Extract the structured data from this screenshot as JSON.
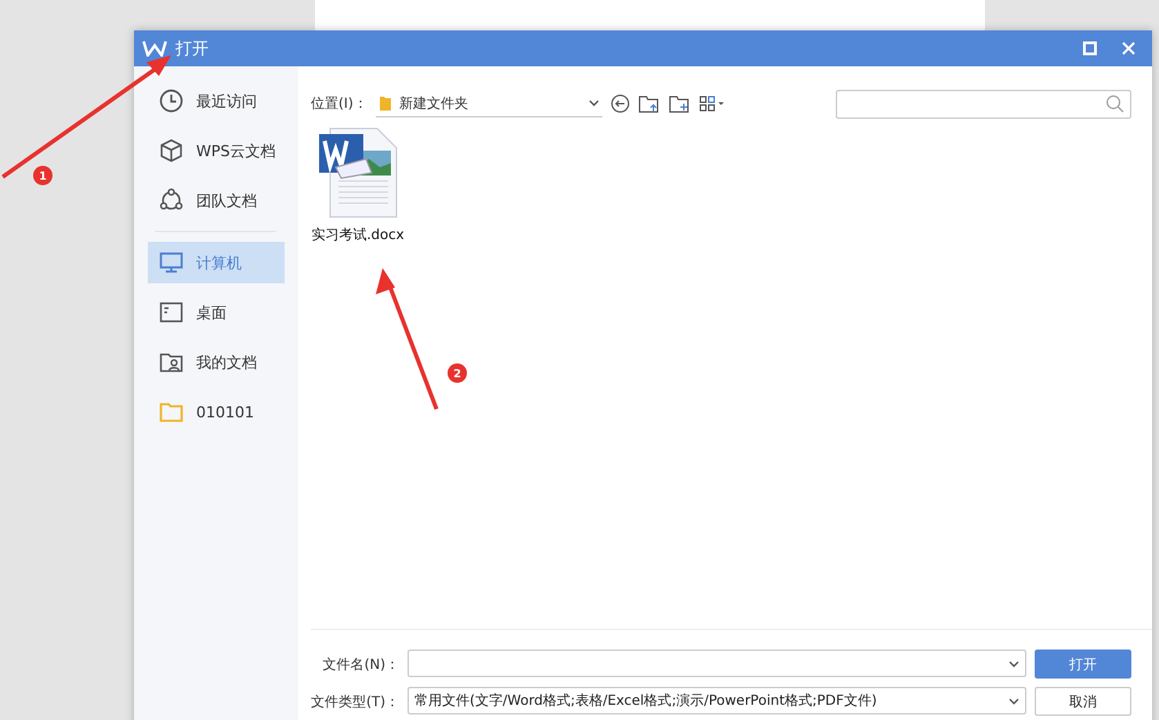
{
  "window": {
    "title": "打开"
  },
  "sidebar": {
    "items": [
      {
        "label": "最近访问",
        "selected": false
      },
      {
        "label": "WPS云文档",
        "selected": false
      },
      {
        "label": "团队文档",
        "selected": false
      },
      {
        "label": "计算机",
        "selected": true
      },
      {
        "label": "桌面",
        "selected": false
      },
      {
        "label": "我的文档",
        "selected": false
      },
      {
        "label": "010101",
        "selected": false
      }
    ]
  },
  "location": {
    "label": "位置(I)：",
    "folder": "新建文件夹"
  },
  "files": [
    {
      "name": "实习考试.docx"
    }
  ],
  "footer": {
    "filename_label": "文件名(N)：",
    "filetype_label": "文件类型(T)：",
    "filetype_value": "常用文件(文字/Word格式;表格/Excel格式;演示/PowerPoint格式;PDF文件)",
    "open_button": "打开",
    "cancel_button": "取消"
  },
  "annotations": [
    {
      "label": "1"
    },
    {
      "label": "2"
    }
  ]
}
